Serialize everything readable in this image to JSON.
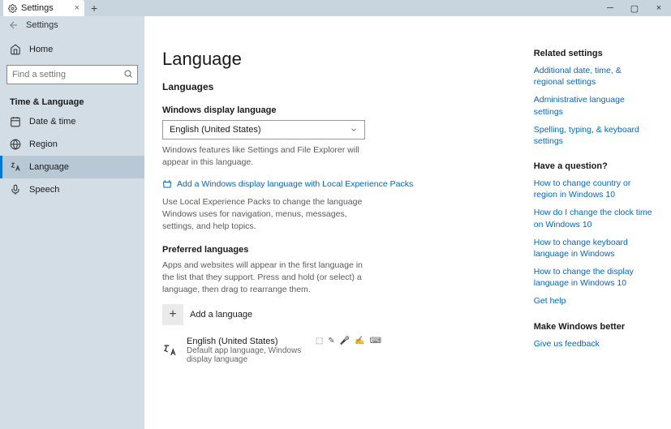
{
  "titlebar": {
    "tab_label": "Settings"
  },
  "header": {
    "title": "Settings"
  },
  "sidebar": {
    "home": "Home",
    "search_placeholder": "Find a setting",
    "category": "Time & Language",
    "items": [
      {
        "label": "Date & time"
      },
      {
        "label": "Region"
      },
      {
        "label": "Language"
      },
      {
        "label": "Speech"
      }
    ]
  },
  "main": {
    "title": "Language",
    "languages_heading": "Languages",
    "display_lang_label": "Windows display language",
    "display_lang_value": "English (United States)",
    "display_lang_desc": "Windows features like Settings and File Explorer will appear in this language.",
    "local_packs_link": "Add a Windows display language with Local Experience Packs",
    "local_packs_desc": "Use Local Experience Packs to change the language Windows uses for navigation, menus, messages, settings, and help topics.",
    "preferred_label": "Preferred languages",
    "preferred_desc": "Apps and websites will appear in the first language in the list that they support. Press and hold (or select) a language, then drag to rearrange them.",
    "add_language": "Add a language",
    "lang_item": {
      "name": "English (United States)",
      "sub": "Default app language, Windows display language"
    }
  },
  "aside": {
    "related": {
      "title": "Related settings",
      "links": [
        "Additional date, time, & regional settings",
        "Administrative language settings",
        "Spelling, typing, & keyboard settings"
      ]
    },
    "question": {
      "title": "Have a question?",
      "links": [
        "How to change country or region in Windows 10",
        "How do I change the clock time on Windows 10",
        "How to change keyboard language in Windows",
        "How to change the display language in Windows 10",
        "Get help"
      ]
    },
    "feedback": {
      "title": "Make Windows better",
      "link": "Give us feedback"
    }
  }
}
